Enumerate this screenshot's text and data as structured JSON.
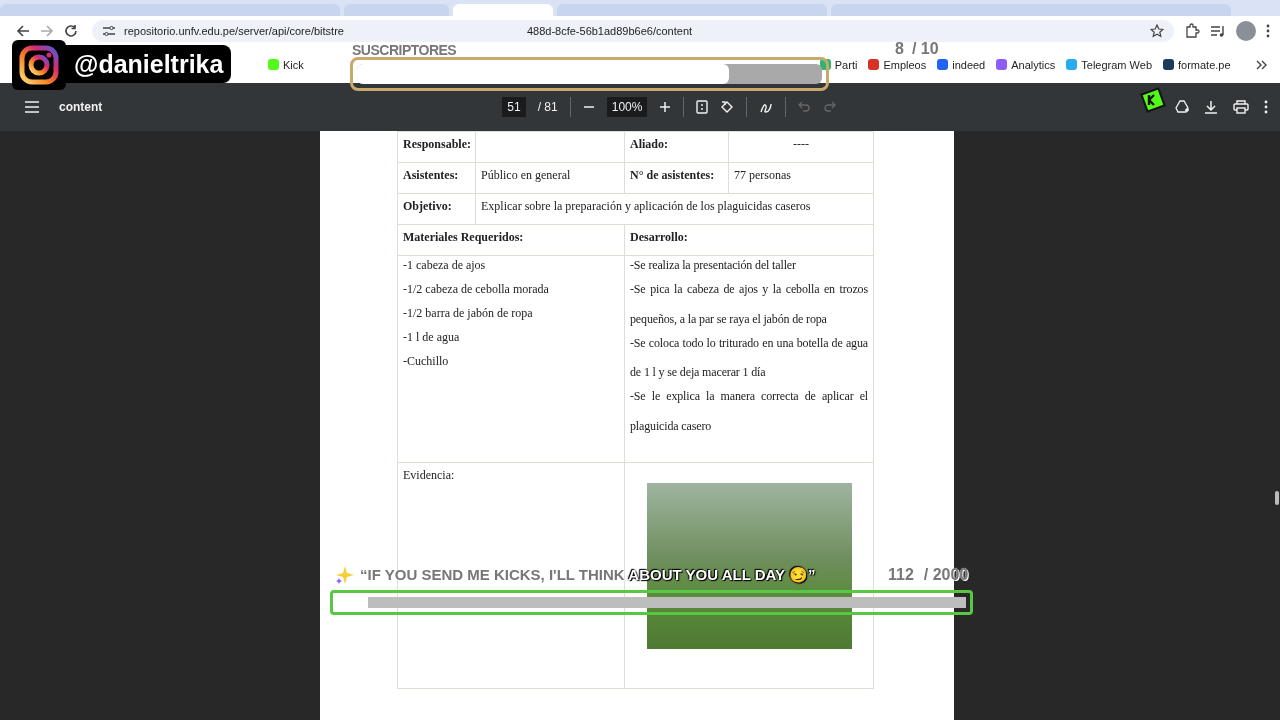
{
  "browser": {
    "tabs": [
      {
        "selected": false
      },
      {
        "selected": false
      },
      {
        "selected": true
      },
      {
        "selected": false
      },
      {
        "selected": false
      }
    ],
    "url_start": "repositorio.unfv.edu.pe/server/api/core/bitstre",
    "url_end": "488d-8cfe-56b1ad89b6e6/content",
    "bookmarks_left": [
      {
        "label": "Kick",
        "color": "#53fc18"
      }
    ],
    "bookmarks_right": [
      {
        "label": "Parti",
        "color": "#2bb673"
      },
      {
        "label": "Empleos",
        "color": "#d93025"
      },
      {
        "label": "indeed",
        "color": "#2164f3"
      },
      {
        "label": "Analytics",
        "color": "#8e5cf7"
      },
      {
        "label": "Telegram Web",
        "color": "#2aabee"
      },
      {
        "label": "formate.pe",
        "color": "#1d3b5a"
      }
    ]
  },
  "pdf_viewer": {
    "title": "content",
    "page": "51",
    "page_count": "/ 81",
    "zoom": "100%",
    "undo_disabled": true,
    "redo_disabled": true
  },
  "document": {
    "responsable_label": "Responsable:",
    "aliado_label": "Aliado:",
    "aliado_value": "----",
    "asistentes_label": "Asistentes:",
    "asistentes_value": "Público en general",
    "n_asistentes_label": "N° de asistentes:",
    "n_asistentes_value": "77 personas",
    "objetivo_label": "Objetivo:",
    "objetivo_value": "Explicar sobre la preparación y aplicación de los plaguicidas caseros",
    "materiales_label": "Materiales Requeridos:",
    "desarrollo_label": "Desarrollo:",
    "materiales": [
      "-1 cabeza de ajos",
      "-1/2 cabeza de cebolla morada",
      "-1/2 barra de jabón de ropa",
      "-1 l de agua",
      "-Cuchillo"
    ],
    "desarrollo": [
      "-Se realiza la presentación del taller",
      "-Se pica la cabeza de ajos y la cebolla en trozos pequeños, a la par se raya el jabón de ropa",
      "-Se coloca todo lo triturado en una botella de agua de 1 l y se deja macerar 1 día",
      "-Se le explica la manera correcta de aplicar el plaguicida casero"
    ],
    "evidencia_label": "Evidencia:"
  },
  "overlays": {
    "instagram_handle": "@danieltrika",
    "subscriber_goal": {
      "title": "SUSCRIPTORES",
      "count": "8",
      "total": "/ 10",
      "level": 0.8
    },
    "kicks_goal": {
      "message_dim": "“IF YOU SEND ME KICKS, I'LL THINK",
      "message_bright": "ABOUT YOU ALL DAY 😏”",
      "count": "112",
      "total": "/ 2000",
      "level": 0.05
    }
  }
}
